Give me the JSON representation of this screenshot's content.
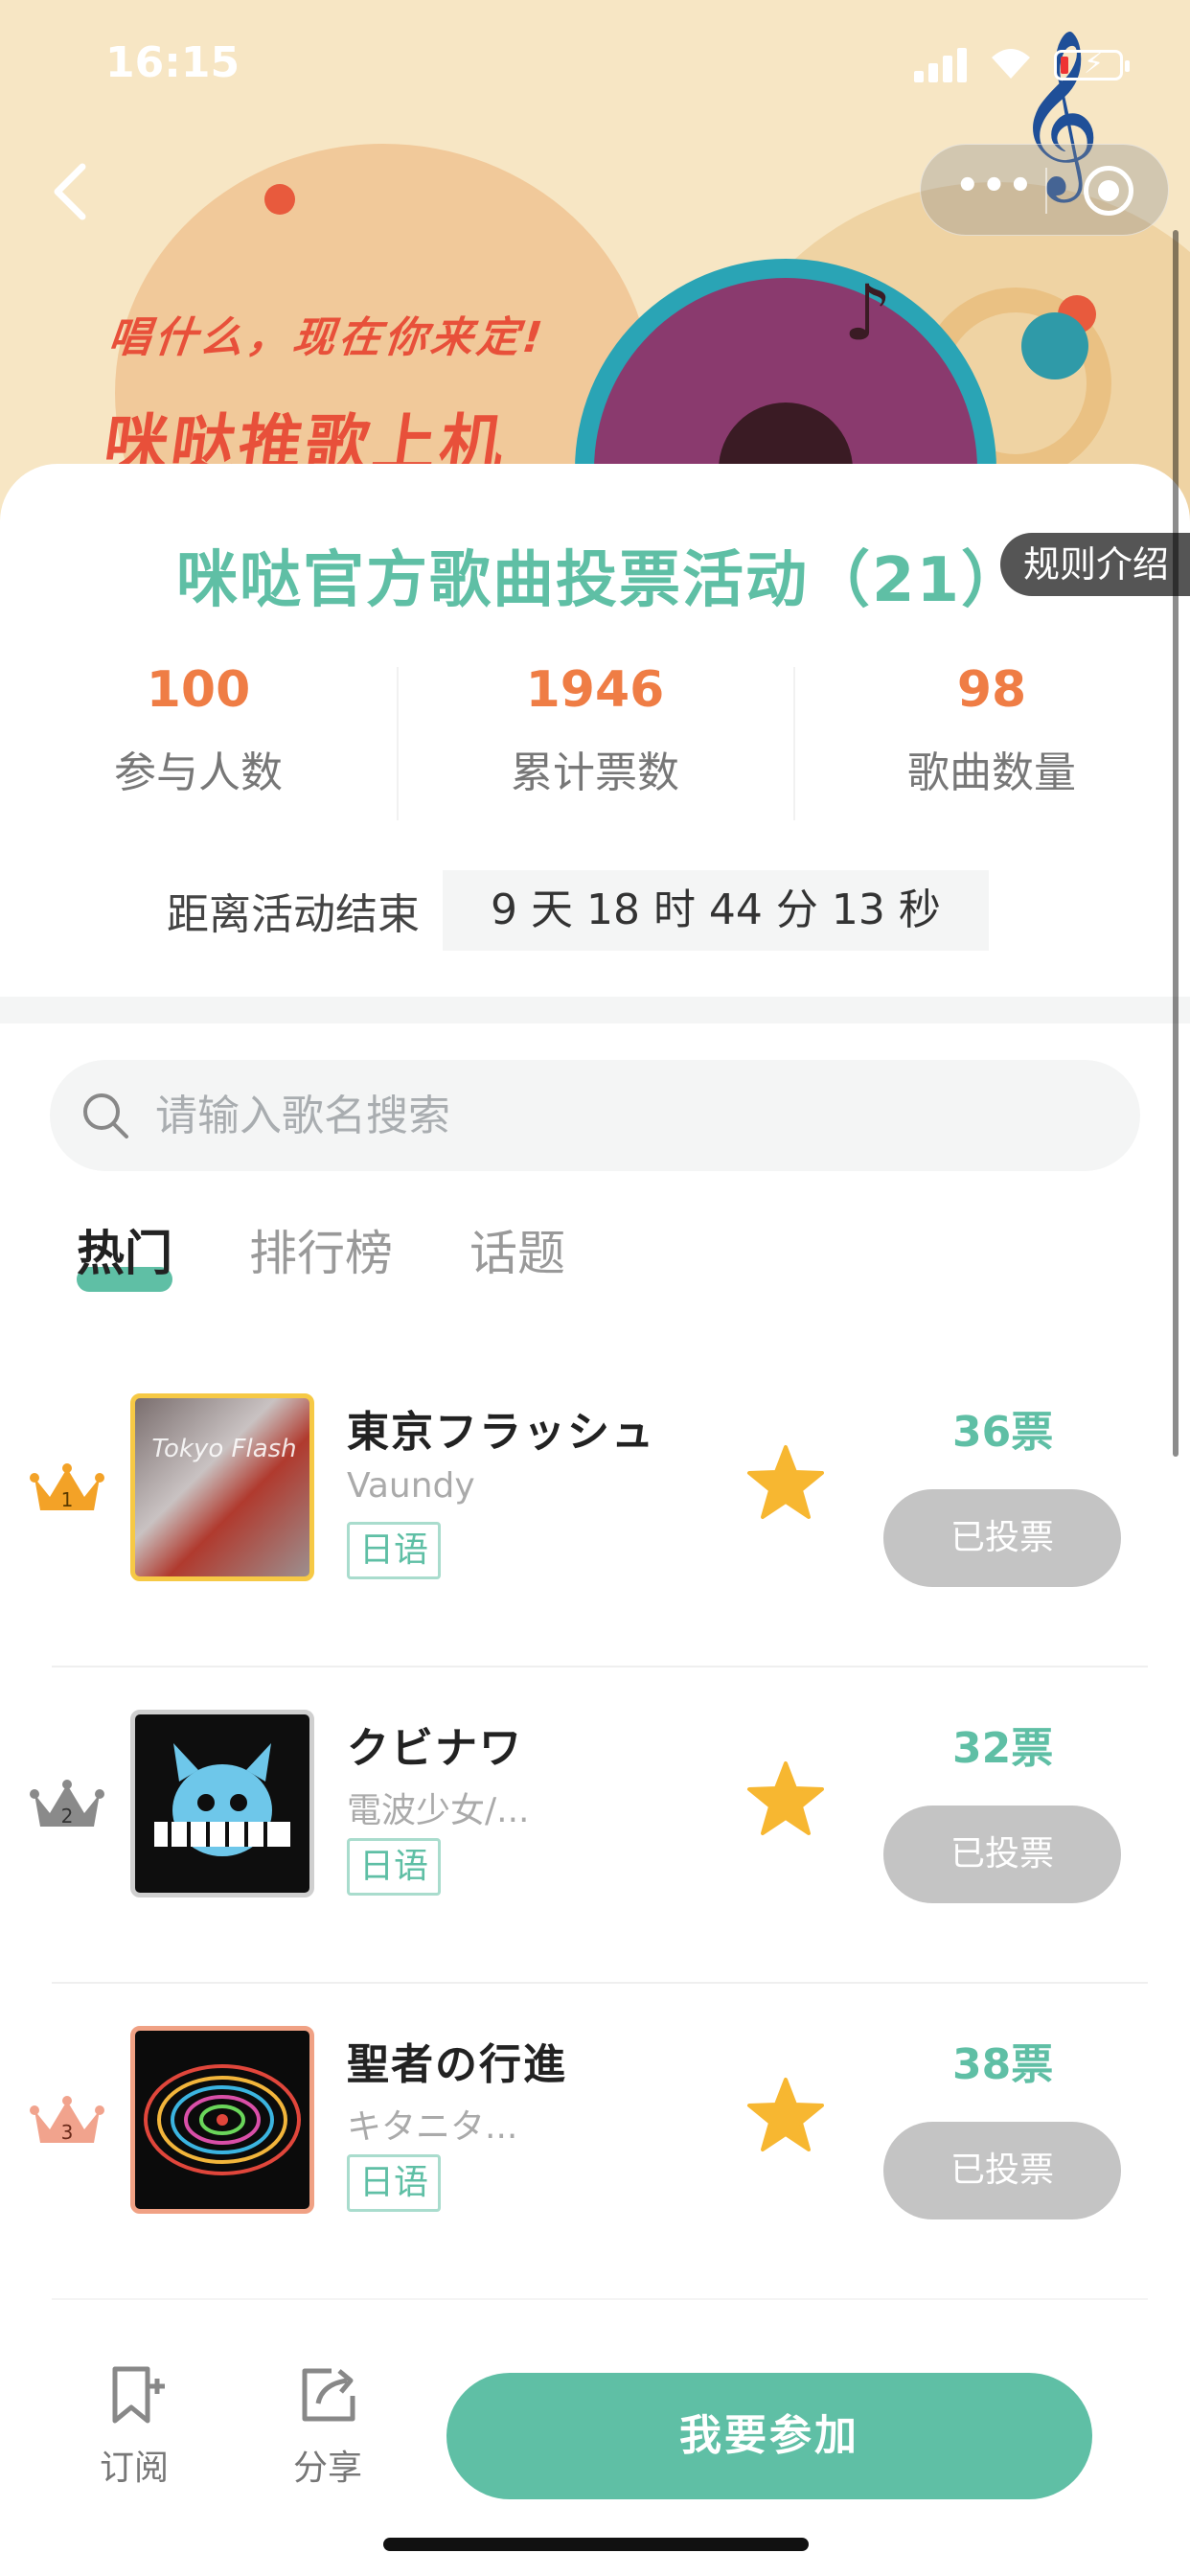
{
  "status_bar": {
    "time": "16:15"
  },
  "banner": {
    "slogan": "唱什么，现在你来定!",
    "title": "咪哒推歌上机"
  },
  "activity": {
    "title": "咪哒官方歌曲投票活动（21）",
    "rules_label": "规则介绍",
    "stats": [
      {
        "value": "100",
        "label": "参与人数"
      },
      {
        "value": "1946",
        "label": "累计票数"
      },
      {
        "value": "98",
        "label": "歌曲数量"
      }
    ],
    "countdown_label": "距离活动结束",
    "countdown_value": "9 天 18 时 44 分 13 秒"
  },
  "search": {
    "placeholder": "请输入歌名搜索"
  },
  "tabs": [
    {
      "label": "热门",
      "active": true
    },
    {
      "label": "排行榜",
      "active": false
    },
    {
      "label": "话题",
      "active": false
    }
  ],
  "songs": [
    {
      "rank": "1",
      "title": "東京フラッシュ",
      "artist": "Vaundy",
      "language": "日语",
      "votes": "36票",
      "vote_button": "已投票",
      "crown_color": "#f3a227",
      "cover_border": "#f6c945"
    },
    {
      "rank": "2",
      "title": "クビナワ",
      "artist": "電波少女/...",
      "language": "日语",
      "votes": "32票",
      "vote_button": "已投票",
      "crown_color": "#8a8a8a",
      "cover_border": "#cfcfcf"
    },
    {
      "rank": "3",
      "title": "聖者の行進",
      "artist": "キタニタ...",
      "language": "日语",
      "votes": "38票",
      "vote_button": "已投票",
      "crown_color": "#f1a38d",
      "cover_border": "#f0a184"
    }
  ],
  "bottom_bar": {
    "subscribe_label": "订阅",
    "share_label": "分享",
    "join_label": "我要参加"
  },
  "colors": {
    "accent": "#5fbfa5",
    "stat_value": "#ef7d45",
    "banner_text": "#e8503a"
  }
}
